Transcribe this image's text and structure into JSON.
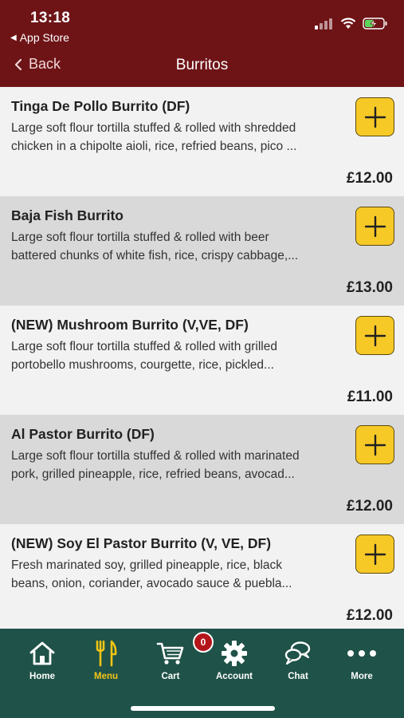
{
  "status": {
    "time": "13:18",
    "back_app": "App Store"
  },
  "nav": {
    "back_label": "Back",
    "title": "Burritos"
  },
  "items": [
    {
      "name": "Tinga De Pollo Burrito (DF)",
      "desc_line1": "Large soft flour tortilla stuffed & rolled with shredded",
      "desc_line2": "chicken in a chipolte aioli, rice, refried beans, pico ...",
      "price": "£12.00"
    },
    {
      "name": "Baja Fish Burrito",
      "desc_line1": "Large soft flour tortilla stuffed & rolled with beer",
      "desc_line2": "battered chunks of white fish, rice, crispy cabbage,...",
      "price": "£13.00"
    },
    {
      "name": "(NEW) Mushroom Burrito (V,VE, DF)",
      "desc_line1": "Large soft flour tortilla stuffed & rolled with grilled",
      "desc_line2": "portobello mushrooms, courgette, rice, pickled...",
      "price": "£11.00"
    },
    {
      "name": "Al Pastor Burrito (DF)",
      "desc_line1": "Large soft flour tortilla stuffed & rolled with marinated",
      "desc_line2": "pork, grilled pineapple, rice, refried beans, avocad...",
      "price": "£12.00"
    },
    {
      "name": "(NEW) Soy El Pastor Burrito (V, VE, DF)",
      "desc_line1": "Fresh marinated soy, grilled pineapple, rice, black",
      "desc_line2": "beans, onion, coriander, avocado sauce & puebla...",
      "price": "£12.00"
    }
  ],
  "tabs": {
    "home": "Home",
    "menu": "Menu",
    "cart": "Cart",
    "cart_count": "0",
    "account": "Account",
    "chat": "Chat",
    "more": "More"
  },
  "colors": {
    "header": "#6e1417",
    "tabbar": "#1f5248",
    "accent": "#f7c926",
    "active_tab": "#f2c417",
    "badge": "#b3151b"
  }
}
